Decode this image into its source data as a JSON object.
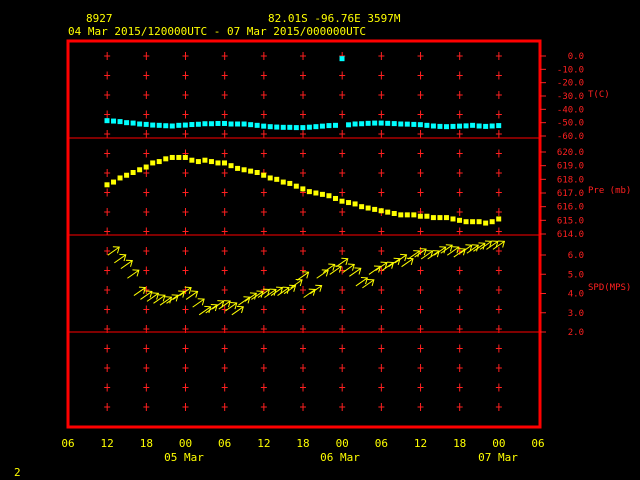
{
  "header": {
    "station": "8927",
    "location": "82.01S  -96.76E  3597M",
    "period": "04 Mar 2015/120000UTC - 07 Mar 2015/000000UTC"
  },
  "corner_label": "2",
  "colors": {
    "frame": "#ff0000",
    "grid": "#ff2020",
    "temperature": "#00ffff",
    "pressure": "#ffff00",
    "wind": "#ffff00",
    "labels": "#ffff00"
  },
  "x_axis": {
    "tick_labels": [
      "06",
      "12",
      "18",
      "00",
      "06",
      "12",
      "18",
      "00",
      "06",
      "12",
      "18",
      "00",
      "06"
    ],
    "day_labels": [
      "05 Mar",
      "06 Mar",
      "07 Mar"
    ]
  },
  "chart_data": [
    {
      "type": "scatter",
      "ylabel": "T(C)",
      "ylim": [
        -60,
        0
      ],
      "yticks": [
        "0.0",
        "-10.0",
        "-20.0",
        "-30.0",
        "-40.0",
        "-50.0",
        "-60.0"
      ],
      "series": [
        {
          "x_hours": [
            0,
            1,
            2,
            3,
            4,
            5,
            6,
            7,
            8,
            9,
            10,
            11,
            12,
            13,
            14,
            15,
            16,
            17,
            18,
            19,
            20,
            21,
            22,
            23,
            24,
            25,
            26,
            27,
            28,
            29,
            30,
            31,
            32,
            33,
            34,
            35,
            36,
            37,
            38,
            39,
            40,
            41,
            42,
            43,
            44,
            45,
            46,
            47,
            48,
            49,
            50,
            51,
            52,
            53,
            54,
            55,
            56,
            57,
            58,
            59,
            60
          ],
          "values": [
            -48.5,
            -48.8,
            -49.2,
            -50.0,
            -50.3,
            -51.0,
            -51.3,
            -51.8,
            -52.0,
            -52.3,
            -52.5,
            -52.0,
            -51.8,
            -51.4,
            -51.2,
            -50.8,
            -50.8,
            -50.6,
            -50.6,
            -51.0,
            -51.0,
            -51.0,
            -51.5,
            -52.0,
            -52.6,
            -53.0,
            -53.3,
            -53.5,
            -53.5,
            -53.7,
            -53.7,
            -53.4,
            -53.0,
            -52.6,
            -52.2,
            -52.0,
            -2.0,
            -51.6,
            -51.0,
            -50.8,
            -50.5,
            -50.3,
            -50.3,
            -50.5,
            -50.7,
            -51.0,
            -51.1,
            -51.3,
            -51.5,
            -52.0,
            -52.5,
            -52.8,
            -53.0,
            -52.8,
            -52.6,
            -52.4,
            -52.0,
            -52.5,
            -52.8,
            -52.5,
            -52.2
          ]
        }
      ]
    },
    {
      "type": "scatter",
      "ylabel": "Pre (mb)",
      "ylim": [
        614.0,
        620.0
      ],
      "yticks": [
        "620.0",
        "619.0",
        "618.0",
        "617.0",
        "616.0",
        "615.0",
        "614.0"
      ],
      "series": [
        {
          "x_hours": [
            0,
            1,
            2,
            3,
            4,
            5,
            6,
            7,
            8,
            9,
            10,
            11,
            12,
            13,
            14,
            15,
            16,
            17,
            18,
            19,
            20,
            21,
            22,
            23,
            24,
            25,
            26,
            27,
            28,
            29,
            30,
            31,
            32,
            33,
            34,
            35,
            36,
            37,
            38,
            39,
            40,
            41,
            42,
            43,
            44,
            45,
            46,
            47,
            48,
            49,
            50,
            51,
            52,
            53,
            54,
            55,
            56,
            57,
            58,
            59,
            60
          ],
          "values": [
            617.6,
            617.8,
            618.1,
            618.3,
            618.5,
            618.7,
            618.9,
            619.2,
            619.3,
            619.5,
            619.6,
            619.6,
            619.6,
            619.4,
            619.3,
            619.4,
            619.3,
            619.2,
            619.2,
            619.0,
            618.8,
            618.7,
            618.6,
            618.5,
            618.3,
            618.1,
            618.0,
            617.8,
            617.7,
            617.5,
            617.3,
            617.1,
            617.0,
            616.9,
            616.8,
            616.6,
            616.4,
            616.3,
            616.2,
            616.0,
            615.9,
            615.8,
            615.7,
            615.6,
            615.5,
            615.4,
            615.4,
            615.4,
            615.3,
            615.3,
            615.2,
            615.2,
            615.2,
            615.1,
            615.0,
            614.9,
            614.9,
            614.9,
            614.8,
            614.9,
            615.1
          ]
        }
      ]
    },
    {
      "type": "scatter",
      "ylabel": "SPD(MPS)",
      "ylim": [
        2.0,
        7.0
      ],
      "yticks": [
        "6.0",
        "5.0",
        "4.0",
        "3.0",
        "2.0"
      ],
      "marker": "wind-arrow",
      "series": [
        {
          "x_hours": [
            1,
            2,
            3,
            4,
            5,
            6,
            7,
            8,
            9,
            10,
            11,
            12,
            13,
            14,
            15,
            16,
            17,
            18,
            19,
            20,
            21,
            22,
            23,
            24,
            25,
            26,
            27,
            28,
            29,
            30,
            31,
            32,
            33,
            34,
            35,
            36,
            37,
            38,
            39,
            40,
            41,
            42,
            43,
            44,
            45,
            46,
            47,
            48,
            49,
            50,
            51,
            52,
            53,
            54,
            55,
            56,
            57,
            58,
            59,
            60
          ],
          "values": [
            6.2,
            5.8,
            5.5,
            5.0,
            4.1,
            3.9,
            3.8,
            3.7,
            3.6,
            3.7,
            3.9,
            4.1,
            3.9,
            3.5,
            3.1,
            3.2,
            3.4,
            3.4,
            3.3,
            3.1,
            3.6,
            3.8,
            3.9,
            4.0,
            4.0,
            4.1,
            4.1,
            4.2,
            4.5,
            4.9,
            4.0,
            4.2,
            5.0,
            5.3,
            5.2,
            5.6,
            5.3,
            5.1,
            4.6,
            4.5,
            5.2,
            5.4,
            5.4,
            5.6,
            5.8,
            5.6,
            6.0,
            6.1,
            6.0,
            6.0,
            6.2,
            6.3,
            6.2,
            6.1,
            6.3,
            6.3,
            6.4,
            6.5,
            6.5,
            6.5
          ]
        }
      ]
    }
  ]
}
